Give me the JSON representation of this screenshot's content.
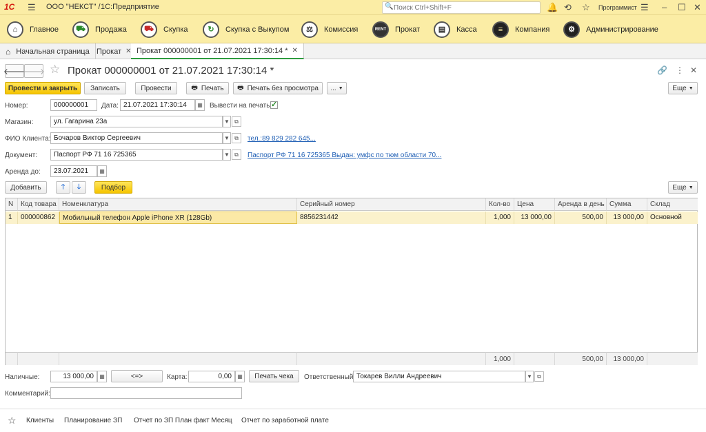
{
  "app": {
    "logo": "1С",
    "org": "ООО \"НЕКСТ\" /",
    "platform": "1С:Предприятие",
    "search_placeholder": "Поиск Ctrl+Shift+F",
    "user": "Программист"
  },
  "sections": [
    {
      "label": "Главное",
      "icon": "home-icon"
    },
    {
      "label": "Продажа",
      "icon": "cart-icon"
    },
    {
      "label": "Скупка",
      "icon": "cart-icon"
    },
    {
      "label": "Скупка с Выкупом",
      "icon": "cycle-icon"
    },
    {
      "label": "Комиссия",
      "icon": "scales-icon"
    },
    {
      "label": "Прокат",
      "icon": "rent-icon"
    },
    {
      "label": "Касса",
      "icon": "cash-register-icon"
    },
    {
      "label": "Компания",
      "icon": "company-icon"
    },
    {
      "label": "Администрирование",
      "icon": "gears-icon"
    }
  ],
  "tabs": [
    {
      "label": "Начальная страница"
    },
    {
      "label": "Прокат"
    },
    {
      "label": "Прокат 000000001 от 21.07.2021 17:30:14 *"
    }
  ],
  "document": {
    "title": "Прокат 000000001 от 21.07.2021 17:30:14 *",
    "toolbar": {
      "post_close": "Провести и закрыть",
      "save": "Записать",
      "post": "Провести",
      "print": "Печать",
      "print_no_preview": "Печать без просмотра",
      "more_menu": "...",
      "more": "Еще"
    },
    "number_label": "Номер:",
    "number": "000000001",
    "date_label": "Дата:",
    "date": "21.07.2021 17:30:14",
    "print_label": "Вывести на печать:",
    "store_label": "Магазин:",
    "store": "ул. Гагарина 23а",
    "client_label": "ФИО Клиента:",
    "client": "Бочаров Виктор Сергеевич",
    "client_phone": "тел.:89 829 282 645...",
    "doc_label": "Документ:",
    "doc": "Паспорт РФ 71 16 725365",
    "doc_link": "Паспорт РФ 71 16 725365 Выдан: умфс по тюм области  70...",
    "rent_until_label": "Аренда до:",
    "rent_until": "23.07.2021"
  },
  "table_toolbar": {
    "add": "Добавить",
    "pick": "Подбор",
    "more": "Еще"
  },
  "table": {
    "headers": [
      "N",
      "Код товара",
      "Номенклатура",
      "Серийный номер",
      "Кол-во",
      "Цена",
      "Аренда в день",
      "Сумма",
      "Склад"
    ],
    "rows": [
      [
        "1",
        "000000862",
        "Мобильный телефон Apple iPhone XR (128Gb)",
        "8856231442",
        "1,000",
        "13 000,00",
        "500,00",
        "13 000,00",
        "Основной"
      ]
    ],
    "totals": {
      "qty": "1,000",
      "daily": "500,00",
      "sum": "13 000,00"
    }
  },
  "payment": {
    "cash_label": "Наличные:",
    "cash": "13 000,00",
    "swap": "<=>",
    "card_label": "Карта:",
    "card": "0,00",
    "receipt_btn": "Печать чека",
    "responsible_label": "Ответственный:",
    "responsible": "Токарев Вилли Андреевич",
    "comment_label": "Комментарий:",
    "comment": ""
  },
  "favorites": [
    "Клиенты",
    "Планирование ЗП",
    "Отчет по ЗП План факт Месяц",
    "Отчет по заработной плате"
  ]
}
